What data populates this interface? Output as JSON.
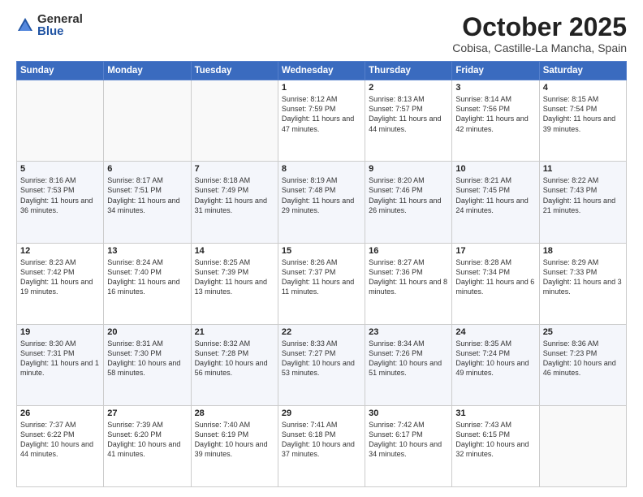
{
  "logo": {
    "general": "General",
    "blue": "Blue"
  },
  "title": "October 2025",
  "subtitle": "Cobisa, Castille-La Mancha, Spain",
  "headers": [
    "Sunday",
    "Monday",
    "Tuesday",
    "Wednesday",
    "Thursday",
    "Friday",
    "Saturday"
  ],
  "weeks": [
    [
      {
        "day": "",
        "info": ""
      },
      {
        "day": "",
        "info": ""
      },
      {
        "day": "",
        "info": ""
      },
      {
        "day": "1",
        "info": "Sunrise: 8:12 AM\nSunset: 7:59 PM\nDaylight: 11 hours and 47 minutes."
      },
      {
        "day": "2",
        "info": "Sunrise: 8:13 AM\nSunset: 7:57 PM\nDaylight: 11 hours and 44 minutes."
      },
      {
        "day": "3",
        "info": "Sunrise: 8:14 AM\nSunset: 7:56 PM\nDaylight: 11 hours and 42 minutes."
      },
      {
        "day": "4",
        "info": "Sunrise: 8:15 AM\nSunset: 7:54 PM\nDaylight: 11 hours and 39 minutes."
      }
    ],
    [
      {
        "day": "5",
        "info": "Sunrise: 8:16 AM\nSunset: 7:53 PM\nDaylight: 11 hours and 36 minutes."
      },
      {
        "day": "6",
        "info": "Sunrise: 8:17 AM\nSunset: 7:51 PM\nDaylight: 11 hours and 34 minutes."
      },
      {
        "day": "7",
        "info": "Sunrise: 8:18 AM\nSunset: 7:49 PM\nDaylight: 11 hours and 31 minutes."
      },
      {
        "day": "8",
        "info": "Sunrise: 8:19 AM\nSunset: 7:48 PM\nDaylight: 11 hours and 29 minutes."
      },
      {
        "day": "9",
        "info": "Sunrise: 8:20 AM\nSunset: 7:46 PM\nDaylight: 11 hours and 26 minutes."
      },
      {
        "day": "10",
        "info": "Sunrise: 8:21 AM\nSunset: 7:45 PM\nDaylight: 11 hours and 24 minutes."
      },
      {
        "day": "11",
        "info": "Sunrise: 8:22 AM\nSunset: 7:43 PM\nDaylight: 11 hours and 21 minutes."
      }
    ],
    [
      {
        "day": "12",
        "info": "Sunrise: 8:23 AM\nSunset: 7:42 PM\nDaylight: 11 hours and 19 minutes."
      },
      {
        "day": "13",
        "info": "Sunrise: 8:24 AM\nSunset: 7:40 PM\nDaylight: 11 hours and 16 minutes."
      },
      {
        "day": "14",
        "info": "Sunrise: 8:25 AM\nSunset: 7:39 PM\nDaylight: 11 hours and 13 minutes."
      },
      {
        "day": "15",
        "info": "Sunrise: 8:26 AM\nSunset: 7:37 PM\nDaylight: 11 hours and 11 minutes."
      },
      {
        "day": "16",
        "info": "Sunrise: 8:27 AM\nSunset: 7:36 PM\nDaylight: 11 hours and 8 minutes."
      },
      {
        "day": "17",
        "info": "Sunrise: 8:28 AM\nSunset: 7:34 PM\nDaylight: 11 hours and 6 minutes."
      },
      {
        "day": "18",
        "info": "Sunrise: 8:29 AM\nSunset: 7:33 PM\nDaylight: 11 hours and 3 minutes."
      }
    ],
    [
      {
        "day": "19",
        "info": "Sunrise: 8:30 AM\nSunset: 7:31 PM\nDaylight: 11 hours and 1 minute."
      },
      {
        "day": "20",
        "info": "Sunrise: 8:31 AM\nSunset: 7:30 PM\nDaylight: 10 hours and 58 minutes."
      },
      {
        "day": "21",
        "info": "Sunrise: 8:32 AM\nSunset: 7:28 PM\nDaylight: 10 hours and 56 minutes."
      },
      {
        "day": "22",
        "info": "Sunrise: 8:33 AM\nSunset: 7:27 PM\nDaylight: 10 hours and 53 minutes."
      },
      {
        "day": "23",
        "info": "Sunrise: 8:34 AM\nSunset: 7:26 PM\nDaylight: 10 hours and 51 minutes."
      },
      {
        "day": "24",
        "info": "Sunrise: 8:35 AM\nSunset: 7:24 PM\nDaylight: 10 hours and 49 minutes."
      },
      {
        "day": "25",
        "info": "Sunrise: 8:36 AM\nSunset: 7:23 PM\nDaylight: 10 hours and 46 minutes."
      }
    ],
    [
      {
        "day": "26",
        "info": "Sunrise: 7:37 AM\nSunset: 6:22 PM\nDaylight: 10 hours and 44 minutes."
      },
      {
        "day": "27",
        "info": "Sunrise: 7:39 AM\nSunset: 6:20 PM\nDaylight: 10 hours and 41 minutes."
      },
      {
        "day": "28",
        "info": "Sunrise: 7:40 AM\nSunset: 6:19 PM\nDaylight: 10 hours and 39 minutes."
      },
      {
        "day": "29",
        "info": "Sunrise: 7:41 AM\nSunset: 6:18 PM\nDaylight: 10 hours and 37 minutes."
      },
      {
        "day": "30",
        "info": "Sunrise: 7:42 AM\nSunset: 6:17 PM\nDaylight: 10 hours and 34 minutes."
      },
      {
        "day": "31",
        "info": "Sunrise: 7:43 AM\nSunset: 6:15 PM\nDaylight: 10 hours and 32 minutes."
      },
      {
        "day": "",
        "info": ""
      }
    ]
  ]
}
